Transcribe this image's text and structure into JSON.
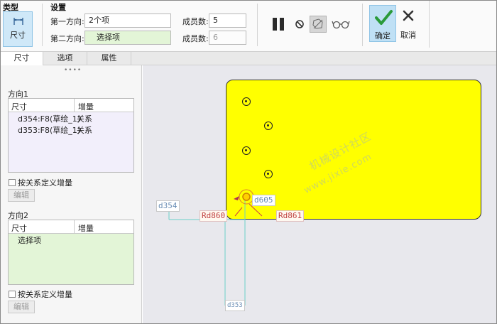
{
  "ribbon": {
    "type_section": "类型",
    "type_button": "尺寸",
    "settings_section": "设置",
    "dir1_label": "第一方向:",
    "dir1_value": "2个项",
    "dir2_label": "第二方向:",
    "dir2_value": "选择项",
    "members1_label": "成员数:",
    "members1_value": "5",
    "members2_label": "成员数:",
    "members2_value": "6",
    "ok_label": "确定",
    "cancel_label": "取消"
  },
  "tabs": [
    {
      "label": "尺寸",
      "active": true
    },
    {
      "label": "选项",
      "active": false
    },
    {
      "label": "属性",
      "active": false
    }
  ],
  "panel": {
    "dir1": {
      "title": "方向1",
      "col_dim": "尺寸",
      "col_inc": "增量",
      "rows": [
        {
          "dim": "d354:F8(草绘_1)",
          "inc": "关系"
        },
        {
          "dim": "d353:F8(草绘_1)",
          "inc": "关系"
        }
      ],
      "checkbox": "按关系定义增量",
      "edit": "编辑"
    },
    "dir2": {
      "title": "方向2",
      "col_dim": "尺寸",
      "col_inc": "增量",
      "rows": [
        {
          "dim": "选择项",
          "inc": ""
        }
      ],
      "checkbox": "按关系定义增量",
      "edit": "编辑"
    }
  },
  "canvas": {
    "dims": {
      "d354": "d354",
      "d605": "d605",
      "rd860": "Rd860",
      "rd861": "Rd861",
      "d353": "d353"
    },
    "watermark1": "机械设计社区",
    "watermark2": "www.jixie.com"
  },
  "colors": {
    "part_fill": "#ffff00",
    "ok_check": "#2a9a3a",
    "green_field": "#e3f5d7",
    "purple_list": "#f2effb"
  }
}
